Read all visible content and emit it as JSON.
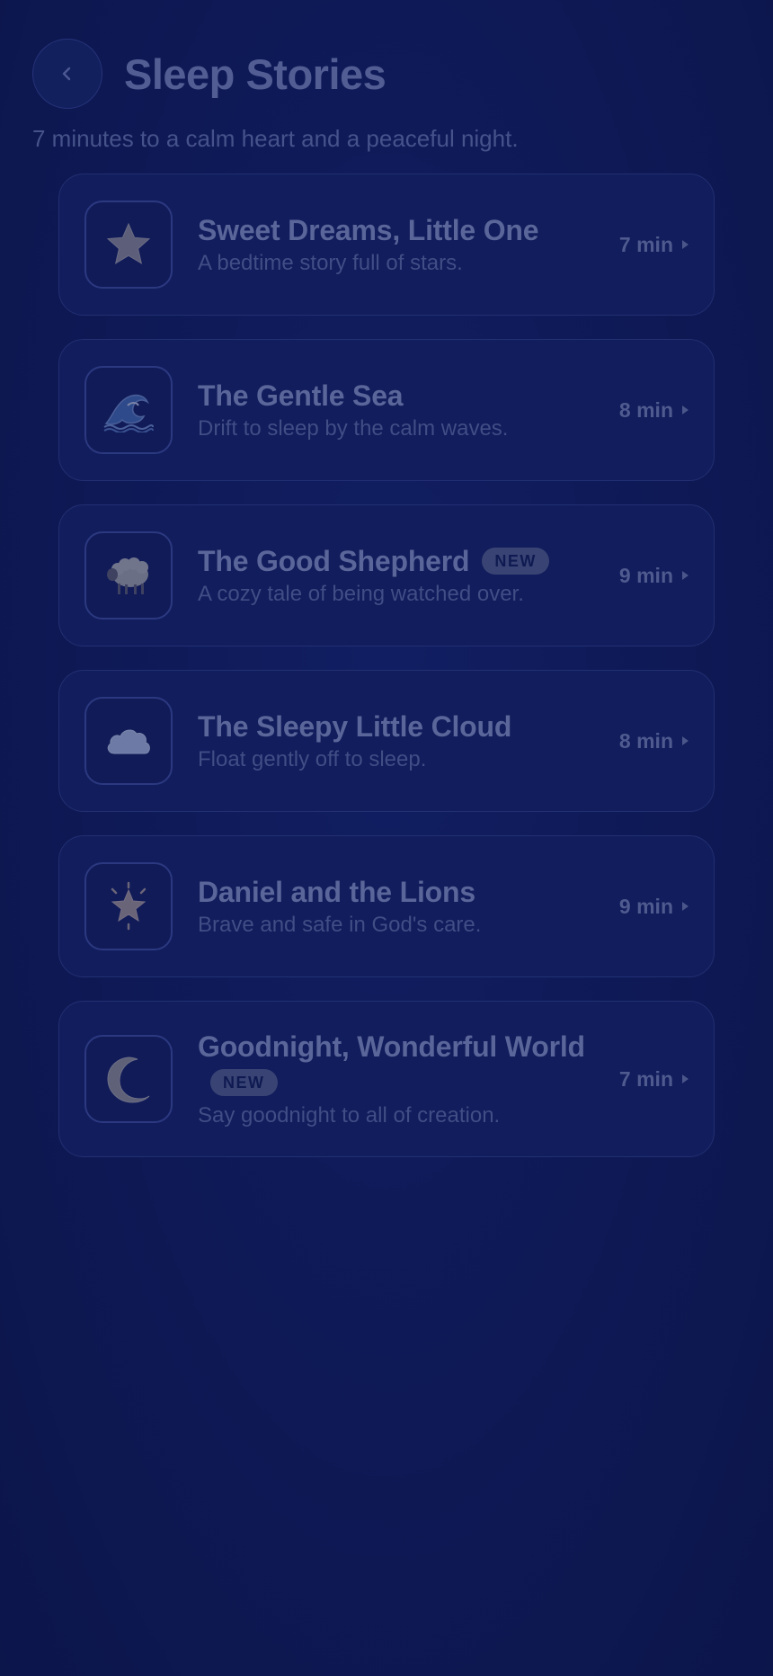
{
  "header": {
    "title": "Sleep Stories",
    "back_icon": "chevron-left-icon"
  },
  "subtitle": "7 minutes to a calm heart and a peaceful night.",
  "colors": {
    "background": "#0f1a52",
    "card": "#111d5c",
    "text": "#5a6599",
    "badge": "#3a4474"
  },
  "stories": [
    {
      "title": "Sweet Dreams, Little One",
      "description": "A bedtime story full of stars.",
      "duration": "7 min",
      "icon": "star-icon",
      "badge": ""
    },
    {
      "title": "The Gentle Sea",
      "description": "Drift to sleep by the calm waves.",
      "duration": "8 min",
      "icon": "wave-icon",
      "badge": ""
    },
    {
      "title": "The Good Shepherd",
      "description": "A cozy tale of being watched over.",
      "duration": "9 min",
      "icon": "sheep-icon",
      "badge": "NEW"
    },
    {
      "title": "The Sleepy Little Cloud",
      "description": "Float gently off to sleep.",
      "duration": "8 min",
      "icon": "cloud-icon",
      "badge": ""
    },
    {
      "title": "Daniel and the Lions",
      "description": "Brave and safe in God's care.",
      "duration": "9 min",
      "icon": "glowing-star-icon",
      "badge": ""
    },
    {
      "title": "Goodnight, Wonderful World",
      "description": "Say goodnight to all of creation.",
      "duration": "7 min",
      "icon": "crescent-moon-icon",
      "badge": "NEW"
    }
  ]
}
